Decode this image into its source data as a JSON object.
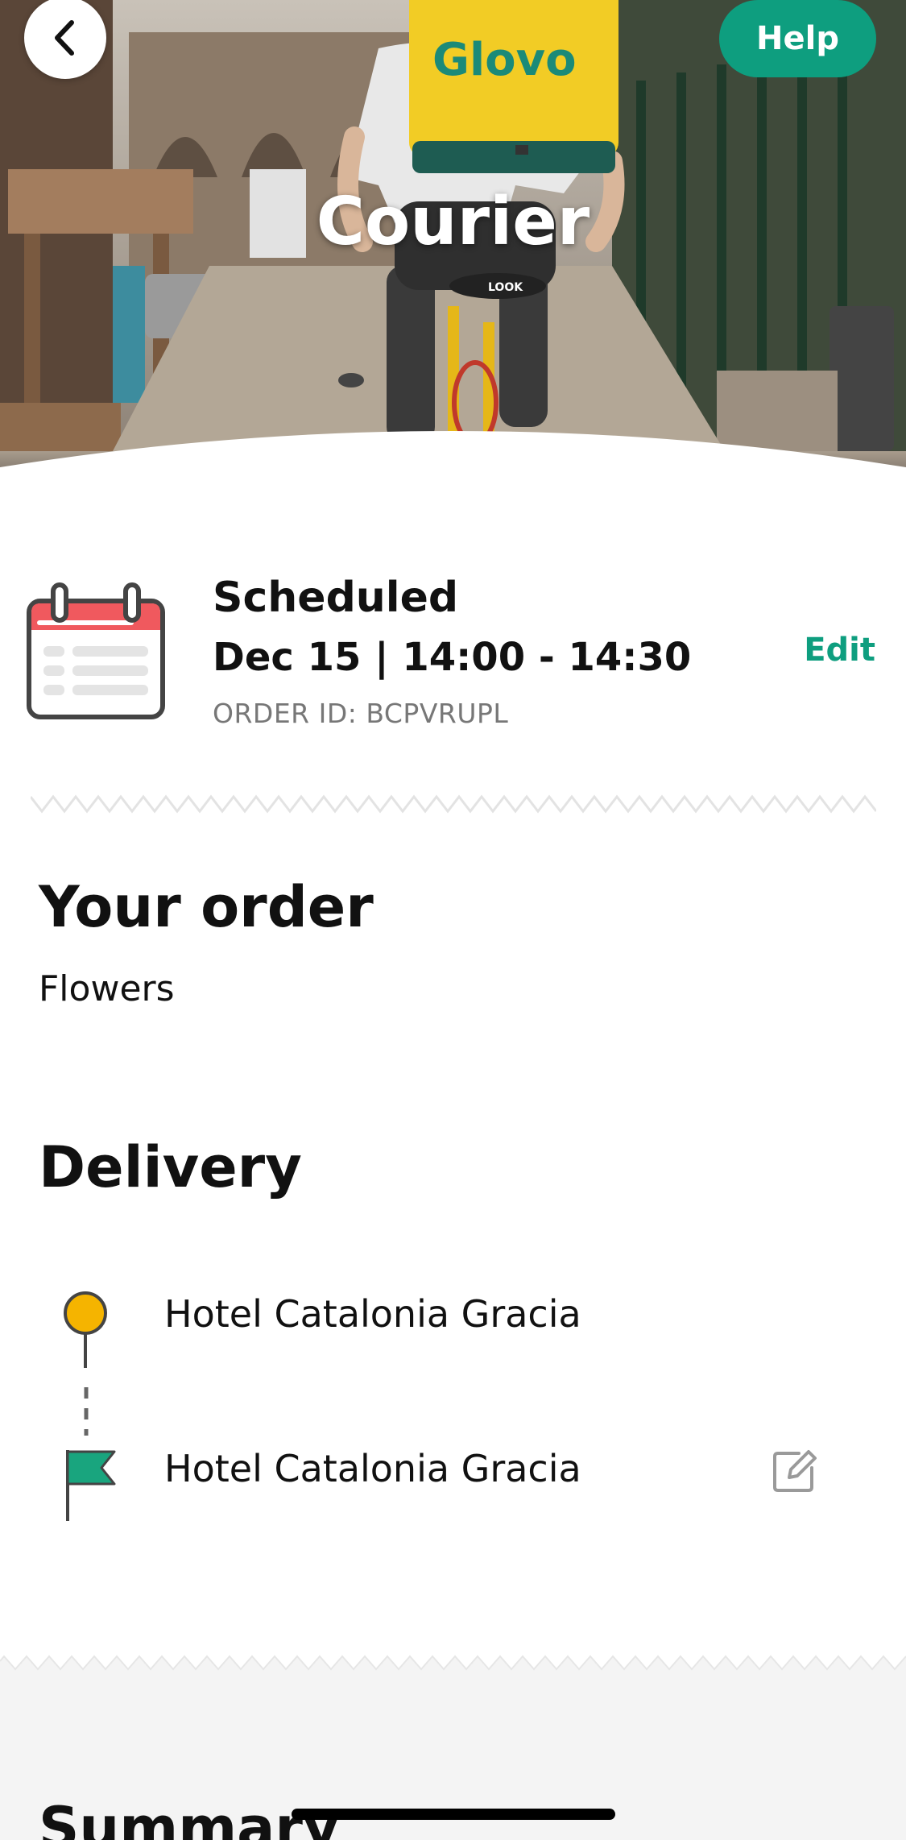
{
  "header": {
    "title": "Courier",
    "back_icon": "chevron-left-icon",
    "help_label": "Help",
    "bag_brand_text": "Glovo",
    "saddle_text": "LOOK"
  },
  "schedule": {
    "icon": "calendar-icon",
    "status": "Scheduled",
    "time": "Dec 15 | 14:00 - 14:30",
    "order_id": "ORDER ID: BCPVRUPL",
    "edit_label": "Edit"
  },
  "order": {
    "heading": "Your order",
    "items": [
      "Flowers"
    ]
  },
  "delivery": {
    "heading": "Delivery",
    "pickup": {
      "icon": "pin-icon",
      "address": "Hotel Catalonia Gracia"
    },
    "dropoff": {
      "icon": "flag-icon",
      "address": "Hotel Catalonia Gracia",
      "edit_icon": "edit-icon"
    }
  },
  "summary": {
    "heading": "Summary"
  },
  "colors": {
    "accent": "#0e9e7f",
    "pin_yellow": "#f5b400",
    "flag_green": "#19a57e",
    "calendar_red": "#f0595e",
    "summary_bg": "#f4f4f4"
  }
}
